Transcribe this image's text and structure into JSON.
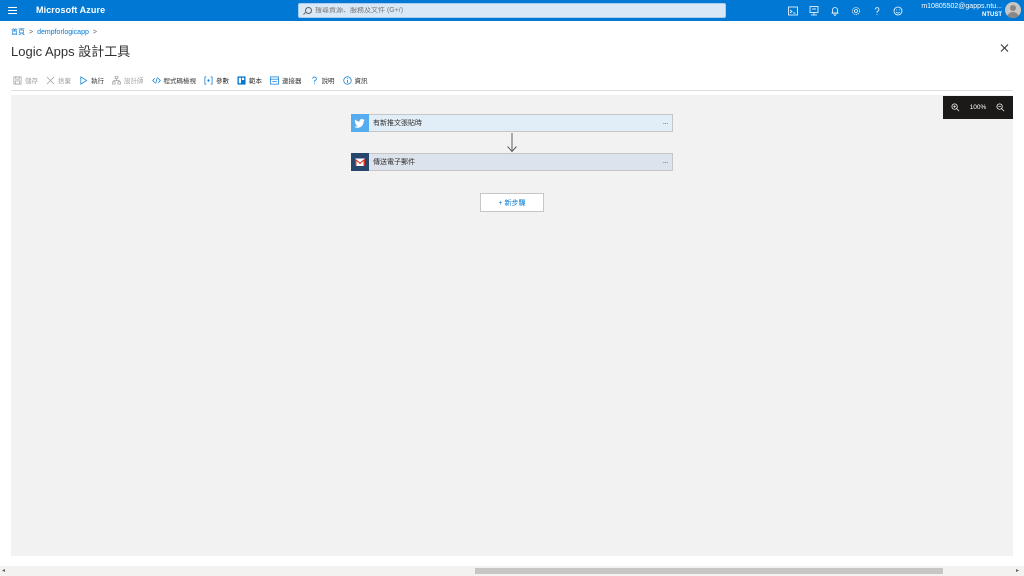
{
  "topbar": {
    "brand": "Microsoft Azure",
    "search_placeholder": "搜尋資源、服務及文件 (G+/)",
    "icons": [
      "cloud-shell-icon",
      "directory-filter-icon",
      "notifications-icon",
      "settings-icon",
      "help-icon",
      "feedback-icon"
    ],
    "account_email": "m10805502@gapps.ntu...",
    "account_org": "NTUST"
  },
  "breadcrumb": {
    "home": "首頁",
    "resource": "dempforlogicapp",
    "separator": ">"
  },
  "page": {
    "title": "Logic Apps 設計工具"
  },
  "toolbar": {
    "save": "儲存",
    "discard": "捨棄",
    "run": "執行",
    "designer": "設計師",
    "code_view": "程式碼檢視",
    "parameters": "參數",
    "templates": "範本",
    "connectors": "連接器",
    "help": "說明",
    "info": "資訊"
  },
  "zoom": {
    "level": "100%"
  },
  "workflow": {
    "trigger": {
      "title": "有新推文張貼時",
      "icon": "twitter-icon",
      "more": "···"
    },
    "action": {
      "title": "傳送電子郵件",
      "icon": "gmail-icon",
      "more": "···"
    },
    "new_step": "+ 新步驟"
  },
  "colors": {
    "azure_blue": "#0078d4",
    "twitter": "#55acee",
    "gmail_bg": "#27466e"
  }
}
